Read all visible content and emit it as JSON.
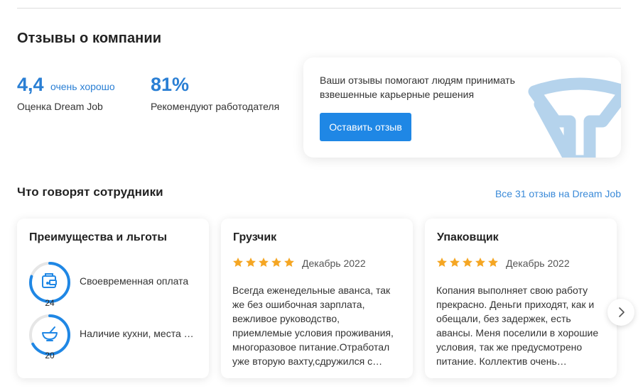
{
  "company_section": {
    "title": "Отзывы о компании",
    "rating_value": "4,4",
    "rating_label": "очень хорошо",
    "rating_caption": "Оценка Dream Job",
    "recommend_value": "81%",
    "recommend_caption": "Рекомендуют работодателя"
  },
  "promo": {
    "text": "Ваши отзывы помогают людям принимать взвешенные карьерные решения",
    "button_label": "Оставить отзыв",
    "logo_icon": "dreamjob-logo-icon"
  },
  "employees_section": {
    "title": "Что говорят сотрудники",
    "all_link": "Все 31 отзыв на Dream Job"
  },
  "benefits_card": {
    "title": "Преимущества и льготы",
    "items": [
      {
        "label": "Своевременная оплата",
        "count": "24",
        "icon": "wallet-icon",
        "progress": 0.8
      },
      {
        "label": "Наличие кухни, места для приема пищи",
        "count": "20",
        "icon": "bowl-icon",
        "progress": 0.67
      }
    ]
  },
  "reviews": [
    {
      "title": "Грузчик",
      "stars": 5,
      "date": "Декабрь 2022",
      "text": "Всегда еженедельные аванса, так же без ошибочная зарплата, вежливое руководство, приемлемые условия проживания, многоразовое питание.Отработал уже вторую вахту,сдружился с…"
    },
    {
      "title": "Упаковщик",
      "stars": 5,
      "date": "Декабрь 2022",
      "text": "Копания выполняет свою работу прекрасно. Деньги приходят, как и обещали, без задержек, есть авансы. Меня поселили в хорошие условия, так же предусмотрено питание. Коллектив очень…"
    }
  ],
  "colors": {
    "accent": "#1f87e5",
    "star": "#f5a623",
    "ring": "#1f87e5",
    "ring_track": "#e6e6e6",
    "logo": "#b5d3ec"
  },
  "carousel": {
    "next_icon": "chevron-right-icon"
  }
}
